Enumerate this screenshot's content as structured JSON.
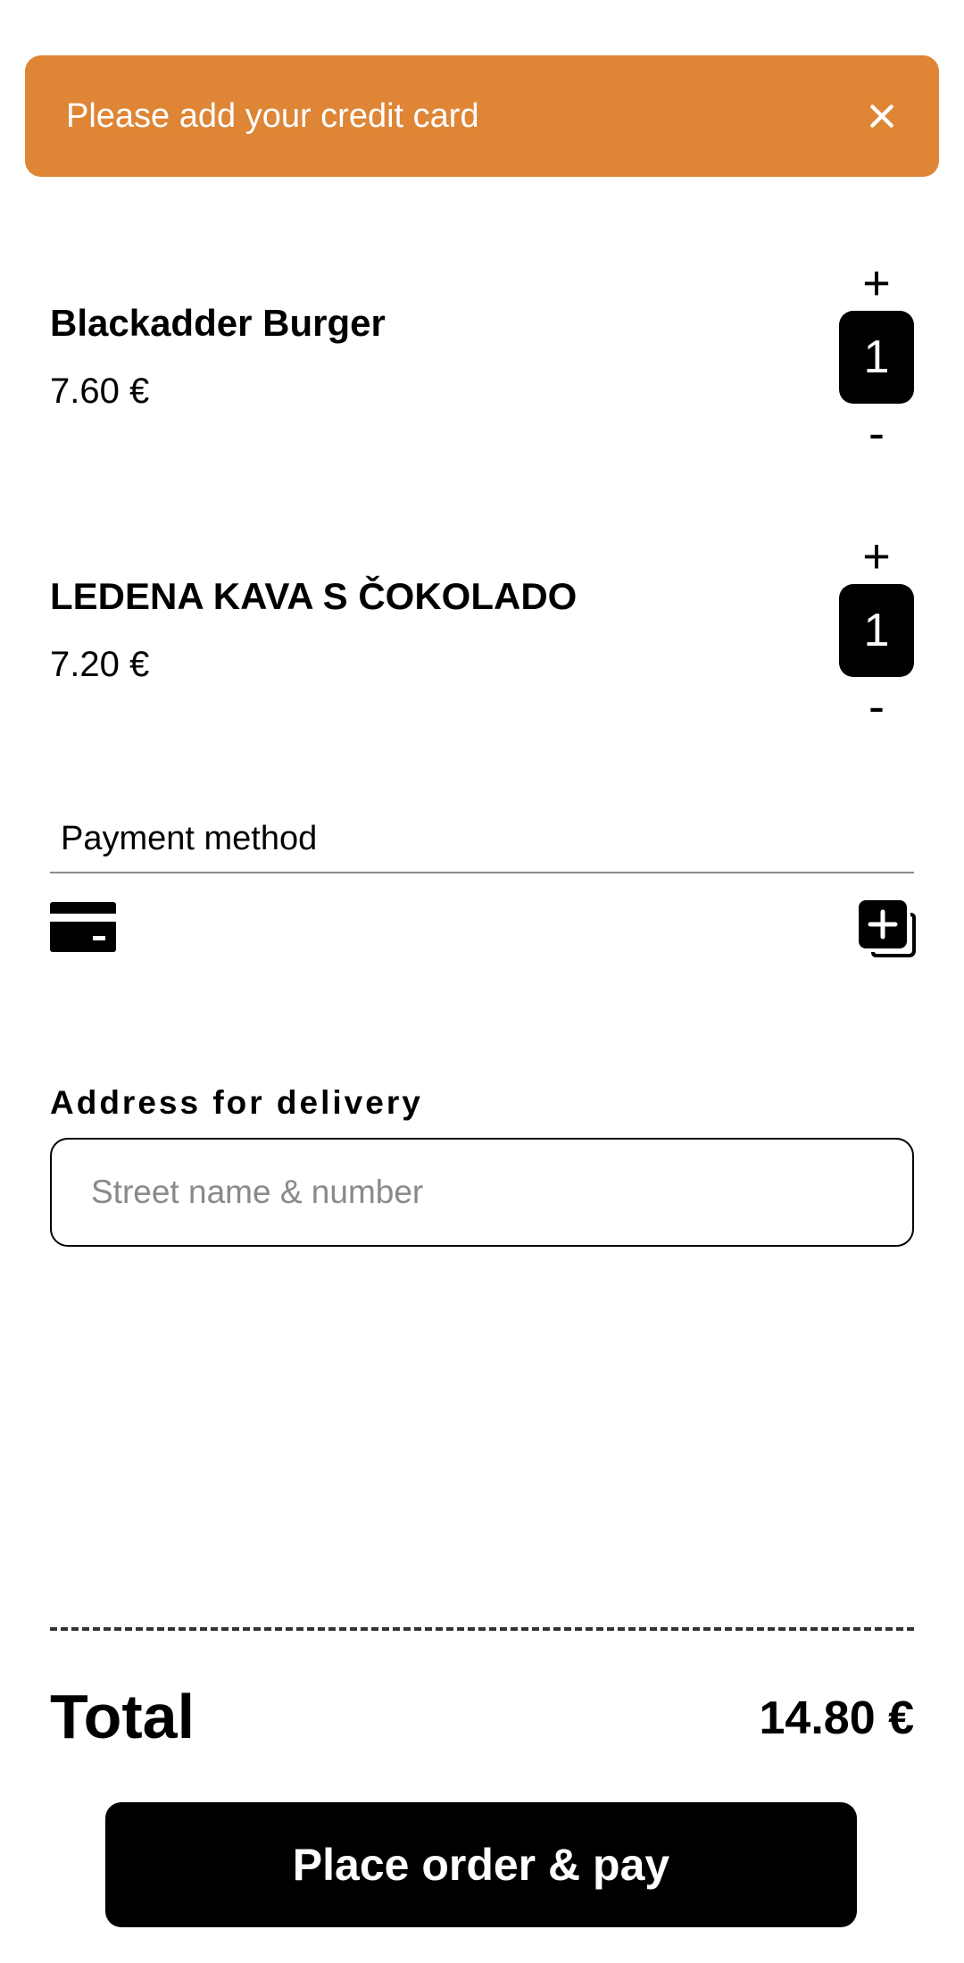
{
  "alert": {
    "message": "Please add your credit card",
    "close_icon": "close-icon",
    "color": "#DE8536"
  },
  "cart": {
    "items": [
      {
        "name": "Blackadder Burger",
        "price": "7.60 €",
        "quantity": "1",
        "increment_label": "+",
        "decrement_label": "-"
      },
      {
        "name": "LEDENA KAVA S ČOKOLADO",
        "price": "7.20 €",
        "quantity": "1",
        "increment_label": "+",
        "decrement_label": "-"
      }
    ]
  },
  "payment": {
    "label": "Payment method",
    "card_icon": "credit-card-icon",
    "add_icon": "add-card-icon"
  },
  "address": {
    "label": "Address for delivery",
    "placeholder": "Street name & number",
    "value": ""
  },
  "summary": {
    "total_label": "Total",
    "total_value": "14.80 €"
  },
  "actions": {
    "place_order_label": "Place order & pay"
  }
}
